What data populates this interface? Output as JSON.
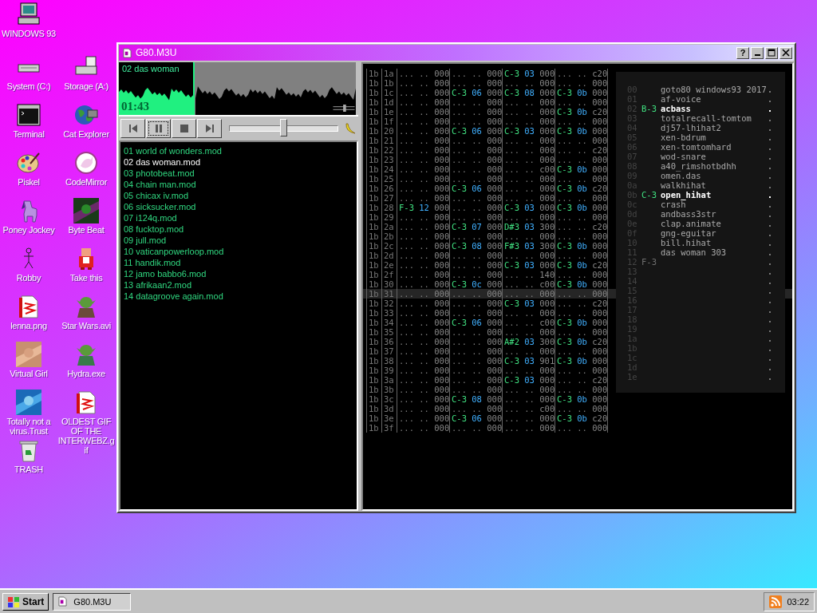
{
  "desktop": {
    "icons": [
      {
        "label": "WINDOWS 93"
      },
      {
        "label": "System (C:)"
      },
      {
        "label": "Storage (A:)"
      },
      {
        "label": "Terminal"
      },
      {
        "label": "Cat Explorer"
      },
      {
        "label": "Piskel"
      },
      {
        "label": "CodeMirror"
      },
      {
        "label": "Poney Jockey"
      },
      {
        "label": "Byte Beat"
      },
      {
        "label": "Robby"
      },
      {
        "label": "Take this"
      },
      {
        "label": "lenna.png"
      },
      {
        "label": "Star Wars.avi"
      },
      {
        "label": "Virtual Girl"
      },
      {
        "label": "Hydra.exe"
      },
      {
        "label": "Totally not a virus.Trust"
      },
      {
        "label": "OLDEST GIF OF THE INTERWEBZ.gif"
      },
      {
        "label": "TRASH"
      }
    ]
  },
  "window": {
    "title": "G80.M3U",
    "help_button": "?"
  },
  "player": {
    "track_title": "02 das woman",
    "time": "01:43",
    "progress": {
      "level": 0.32
    },
    "volume": {
      "level": 0.5
    },
    "playlist": [
      {
        "label": "01 world of wonders.mod",
        "selected": false
      },
      {
        "label": "02 das woman.mod",
        "selected": true
      },
      {
        "label": "03 photobeat.mod",
        "selected": false
      },
      {
        "label": "04 chain man.mod",
        "selected": false
      },
      {
        "label": "05 chicax iv.mod",
        "selected": false
      },
      {
        "label": "06 sicksucker.mod",
        "selected": false
      },
      {
        "label": "07 i124q.mod",
        "selected": false
      },
      {
        "label": "08 fucktop.mod",
        "selected": false
      },
      {
        "label": "09 jull.mod",
        "selected": false
      },
      {
        "label": "10 vaticanpowerloop.mod",
        "selected": false
      },
      {
        "label": "11 handik.mod",
        "selected": false
      },
      {
        "label": "12 jamo babbo6.mod",
        "selected": false
      },
      {
        "label": "13 afrikaan2.mod",
        "selected": false
      },
      {
        "label": "14 datagroove again.mod",
        "selected": false
      }
    ]
  },
  "tracker": {
    "rows": [
      {
        "pattern": "1b",
        "row": "1a",
        "selected": false,
        "channels": [
          "... .. 000",
          "... .. 000",
          "C-3 03 000",
          "... .. c20"
        ]
      },
      {
        "pattern": "1b",
        "row": "1b",
        "selected": false,
        "channels": [
          "... .. 000",
          "... .. 000",
          "... .. 000",
          "... .. 000"
        ]
      },
      {
        "pattern": "1b",
        "row": "1c",
        "selected": false,
        "channels": [
          "... .. 000",
          "C-3 06 000",
          "C-3 08 000",
          "C-3 0b 000"
        ]
      },
      {
        "pattern": "1b",
        "row": "1d",
        "selected": false,
        "channels": [
          "... .. 000",
          "... .. 000",
          "... .. 000",
          "... .. 000"
        ]
      },
      {
        "pattern": "1b",
        "row": "1e",
        "selected": false,
        "channels": [
          "... .. 000",
          "... .. 000",
          "... .. 000",
          "C-3 0b c20"
        ]
      },
      {
        "pattern": "1b",
        "row": "1f",
        "selected": false,
        "channels": [
          "... .. 000",
          "... .. 000",
          "... .. 000",
          "... .. 000"
        ]
      },
      {
        "pattern": "1b",
        "row": "20",
        "selected": false,
        "channels": [
          "... .. 000",
          "C-3 06 000",
          "C-3 03 000",
          "C-3 0b 000"
        ]
      },
      {
        "pattern": "1b",
        "row": "21",
        "selected": false,
        "channels": [
          "... .. 000",
          "... .. 000",
          "... .. 000",
          "... .. 000"
        ]
      },
      {
        "pattern": "1b",
        "row": "22",
        "selected": false,
        "channels": [
          "... .. 000",
          "... .. 000",
          "... .. 000",
          "... .. c20"
        ]
      },
      {
        "pattern": "1b",
        "row": "23",
        "selected": false,
        "channels": [
          "... .. 000",
          "... .. 000",
          "... .. 000",
          "... .. 000"
        ]
      },
      {
        "pattern": "1b",
        "row": "24",
        "selected": false,
        "channels": [
          "... .. 000",
          "... .. 000",
          "... .. c00",
          "C-3 0b 000"
        ]
      },
      {
        "pattern": "1b",
        "row": "25",
        "selected": false,
        "channels": [
          "... .. 000",
          "... .. 000",
          "... .. 000",
          "... .. 000"
        ]
      },
      {
        "pattern": "1b",
        "row": "26",
        "selected": false,
        "channels": [
          "... .. 000",
          "C-3 06 000",
          "... .. 000",
          "C-3 0b c20"
        ]
      },
      {
        "pattern": "1b",
        "row": "27",
        "selected": false,
        "channels": [
          "... .. 000",
          "... .. 000",
          "... .. 000",
          "... .. 000"
        ]
      },
      {
        "pattern": "1b",
        "row": "28",
        "selected": false,
        "channels": [
          "F-3 12 000",
          "... .. 000",
          "C-3 03 000",
          "C-3 0b 000"
        ]
      },
      {
        "pattern": "1b",
        "row": "29",
        "selected": false,
        "channels": [
          "... .. 000",
          "... .. 000",
          "... .. 000",
          "... .. 000"
        ]
      },
      {
        "pattern": "1b",
        "row": "2a",
        "selected": false,
        "channels": [
          "... .. 000",
          "C-3 07 000",
          "D#3 03 300",
          "... .. c20"
        ]
      },
      {
        "pattern": "1b",
        "row": "2b",
        "selected": false,
        "channels": [
          "... .. 000",
          "... .. 000",
          "... .. 000",
          "... .. 000"
        ]
      },
      {
        "pattern": "1b",
        "row": "2c",
        "selected": false,
        "channels": [
          "... .. 000",
          "C-3 08 000",
          "F#3 03 300",
          "C-3 0b 000"
        ]
      },
      {
        "pattern": "1b",
        "row": "2d",
        "selected": false,
        "channels": [
          "... .. 000",
          "... .. 000",
          "... .. 000",
          "... .. 000"
        ]
      },
      {
        "pattern": "1b",
        "row": "2e",
        "selected": false,
        "channels": [
          "... .. 000",
          "... .. 000",
          "C-3 03 000",
          "C-3 0b c20"
        ]
      },
      {
        "pattern": "1b",
        "row": "2f",
        "selected": false,
        "channels": [
          "... .. 000",
          "... .. 000",
          "... .. 140",
          "... .. 000"
        ]
      },
      {
        "pattern": "1b",
        "row": "30",
        "selected": false,
        "channels": [
          "... .. 000",
          "C-3 0c 000",
          "... .. c00",
          "C-3 0b 000"
        ]
      },
      {
        "pattern": "1b",
        "row": "31",
        "selected": true,
        "channels": [
          "... .. 000",
          "... .. 000",
          "... .. 000",
          "... .. 000"
        ]
      },
      {
        "pattern": "1b",
        "row": "32",
        "selected": false,
        "channels": [
          "... .. 000",
          "... .. 000",
          "C-3 03 000",
          "... .. c20"
        ]
      },
      {
        "pattern": "1b",
        "row": "33",
        "selected": false,
        "channels": [
          "... .. 000",
          "... .. 000",
          "... .. 000",
          "... .. 000"
        ]
      },
      {
        "pattern": "1b",
        "row": "34",
        "selected": false,
        "channels": [
          "... .. 000",
          "C-3 06 000",
          "... .. c00",
          "C-3 0b 000"
        ]
      },
      {
        "pattern": "1b",
        "row": "35",
        "selected": false,
        "channels": [
          "... .. 000",
          "... .. 000",
          "... .. 000",
          "... .. 000"
        ]
      },
      {
        "pattern": "1b",
        "row": "36",
        "selected": false,
        "channels": [
          "... .. 000",
          "... .. 000",
          "A#2 03 300",
          "C-3 0b c20"
        ]
      },
      {
        "pattern": "1b",
        "row": "37",
        "selected": false,
        "channels": [
          "... .. 000",
          "... .. 000",
          "... .. 000",
          "... .. 000"
        ]
      },
      {
        "pattern": "1b",
        "row": "38",
        "selected": false,
        "channels": [
          "... .. 000",
          "... .. 000",
          "C-3 03 901",
          "C-3 0b 000"
        ]
      },
      {
        "pattern": "1b",
        "row": "39",
        "selected": false,
        "channels": [
          "... .. 000",
          "... .. 000",
          "... .. 000",
          "... .. 000"
        ]
      },
      {
        "pattern": "1b",
        "row": "3a",
        "selected": false,
        "channels": [
          "... .. 000",
          "... .. 000",
          "C-3 03 000",
          "... .. c20"
        ]
      },
      {
        "pattern": "1b",
        "row": "3b",
        "selected": false,
        "channels": [
          "... .. 000",
          "... .. 000",
          "... .. 000",
          "... .. 000"
        ]
      },
      {
        "pattern": "1b",
        "row": "3c",
        "selected": false,
        "channels": [
          "... .. 000",
          "C-3 08 000",
          "... .. 000",
          "C-3 0b 000"
        ]
      },
      {
        "pattern": "1b",
        "row": "3d",
        "selected": false,
        "channels": [
          "... .. 000",
          "... .. 000",
          "... .. c00",
          "... .. 000"
        ]
      },
      {
        "pattern": "1b",
        "row": "3e",
        "selected": false,
        "channels": [
          "... .. 000",
          "C-3 06 000",
          "... .. 000",
          "C-3 0b c20"
        ]
      },
      {
        "pattern": "1b",
        "row": "3f",
        "selected": false,
        "channels": [
          "... .. 000",
          "... .. 000",
          "... .. 000",
          "... .. 000"
        ]
      }
    ]
  },
  "instruments": [
    {
      "index": "00",
      "name": "goto80 windows93 2017",
      "active": false
    },
    {
      "index": "01",
      "name": "af-voice",
      "active": false
    },
    {
      "index": "02",
      "note": "B-3",
      "name": "acbass",
      "active": true
    },
    {
      "index": "03",
      "name": "totalrecall-tomtom",
      "active": false
    },
    {
      "index": "04",
      "name": "dj57-lhihat2",
      "active": false
    },
    {
      "index": "05",
      "name": "xen-bdrum",
      "active": false
    },
    {
      "index": "06",
      "name": "xen-tomtomhard",
      "active": false
    },
    {
      "index": "07",
      "name": "wod-snare",
      "active": false
    },
    {
      "index": "08",
      "name": "a40_rimshotbdhh",
      "active": false
    },
    {
      "index": "09",
      "name": "omen.das",
      "active": false
    },
    {
      "index": "0a",
      "name": "walkhihat",
      "active": false
    },
    {
      "index": "0b",
      "note": "C-3",
      "name": "open_hihat",
      "active": true
    },
    {
      "index": "0c",
      "name": "crash",
      "active": false
    },
    {
      "index": "0d",
      "name": "andbass3str",
      "active": false
    },
    {
      "index": "0e",
      "name": "clap.animate",
      "active": false
    },
    {
      "index": "0f",
      "name": "gng-eguitar",
      "active": false
    },
    {
      "index": "10",
      "name": "bill.hihat",
      "active": false
    },
    {
      "index": "11",
      "name": "das woman 303",
      "active": false
    },
    {
      "index": "12",
      "note": "F-3",
      "active": false
    },
    {
      "index": "13",
      "active": false
    },
    {
      "index": "14",
      "active": false
    },
    {
      "index": "15",
      "active": false
    },
    {
      "index": "16",
      "active": false
    },
    {
      "index": "17",
      "active": false
    },
    {
      "index": "18",
      "active": false
    },
    {
      "index": "19",
      "active": false
    },
    {
      "index": "1a",
      "active": false
    },
    {
      "index": "1b",
      "active": false
    },
    {
      "index": "1c",
      "active": false
    },
    {
      "index": "1d",
      "active": false
    },
    {
      "index": "1e",
      "active": false
    }
  ],
  "taskbar": {
    "start": "Start",
    "tasks": [
      {
        "label": "G80.M3U"
      }
    ],
    "clock": "03:22"
  }
}
